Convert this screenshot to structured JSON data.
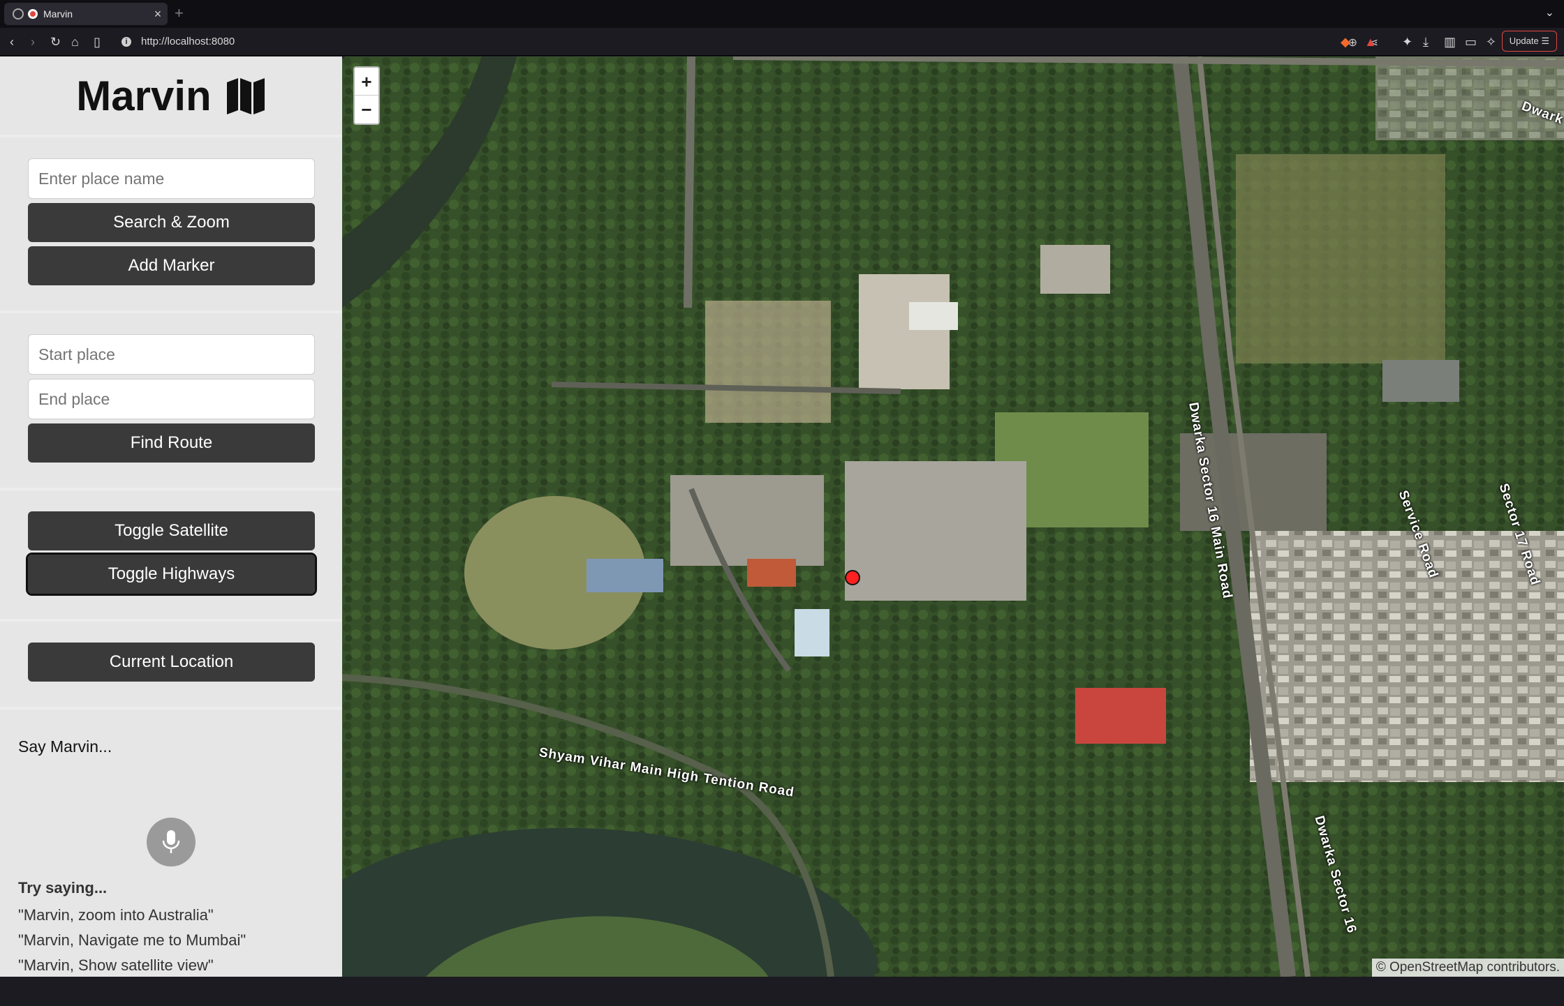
{
  "browser": {
    "tab_title": "Marvin",
    "url": "http://localhost:8080",
    "update_label": "Update"
  },
  "app": {
    "brand": "Marvin",
    "search": {
      "placeholder": "Enter place name",
      "search_button": "Search & Zoom",
      "marker_button": "Add Marker"
    },
    "route": {
      "start_placeholder": "Start place",
      "end_placeholder": "End place",
      "route_button": "Find Route"
    },
    "layers": {
      "satellite_button": "Toggle Satellite",
      "highways_button": "Toggle Highways"
    },
    "location": {
      "location_button": "Current Location"
    },
    "voice": {
      "prompt": "Say Marvin...",
      "try_title": "Try saying...",
      "examples": [
        "\"Marvin, zoom into Australia\"",
        "\"Marvin, Navigate me to Mumbai\"",
        "\"Marvin, Show satellite view\""
      ]
    }
  },
  "map": {
    "zoom_in": "+",
    "zoom_out": "−",
    "attribution": "© OpenStreetMap contributors.",
    "labels": {
      "shyam": "Shyam Vihar Main High Tention Road",
      "dwarka16": "Dwarka Sector 16 Main Road",
      "dwarka16b": "Dwarka Sector 16",
      "service": "Service Road",
      "sector17": "Sector 17 Road",
      "dwarka_top": "Dwark"
    },
    "marker_color": "#ff2020"
  }
}
